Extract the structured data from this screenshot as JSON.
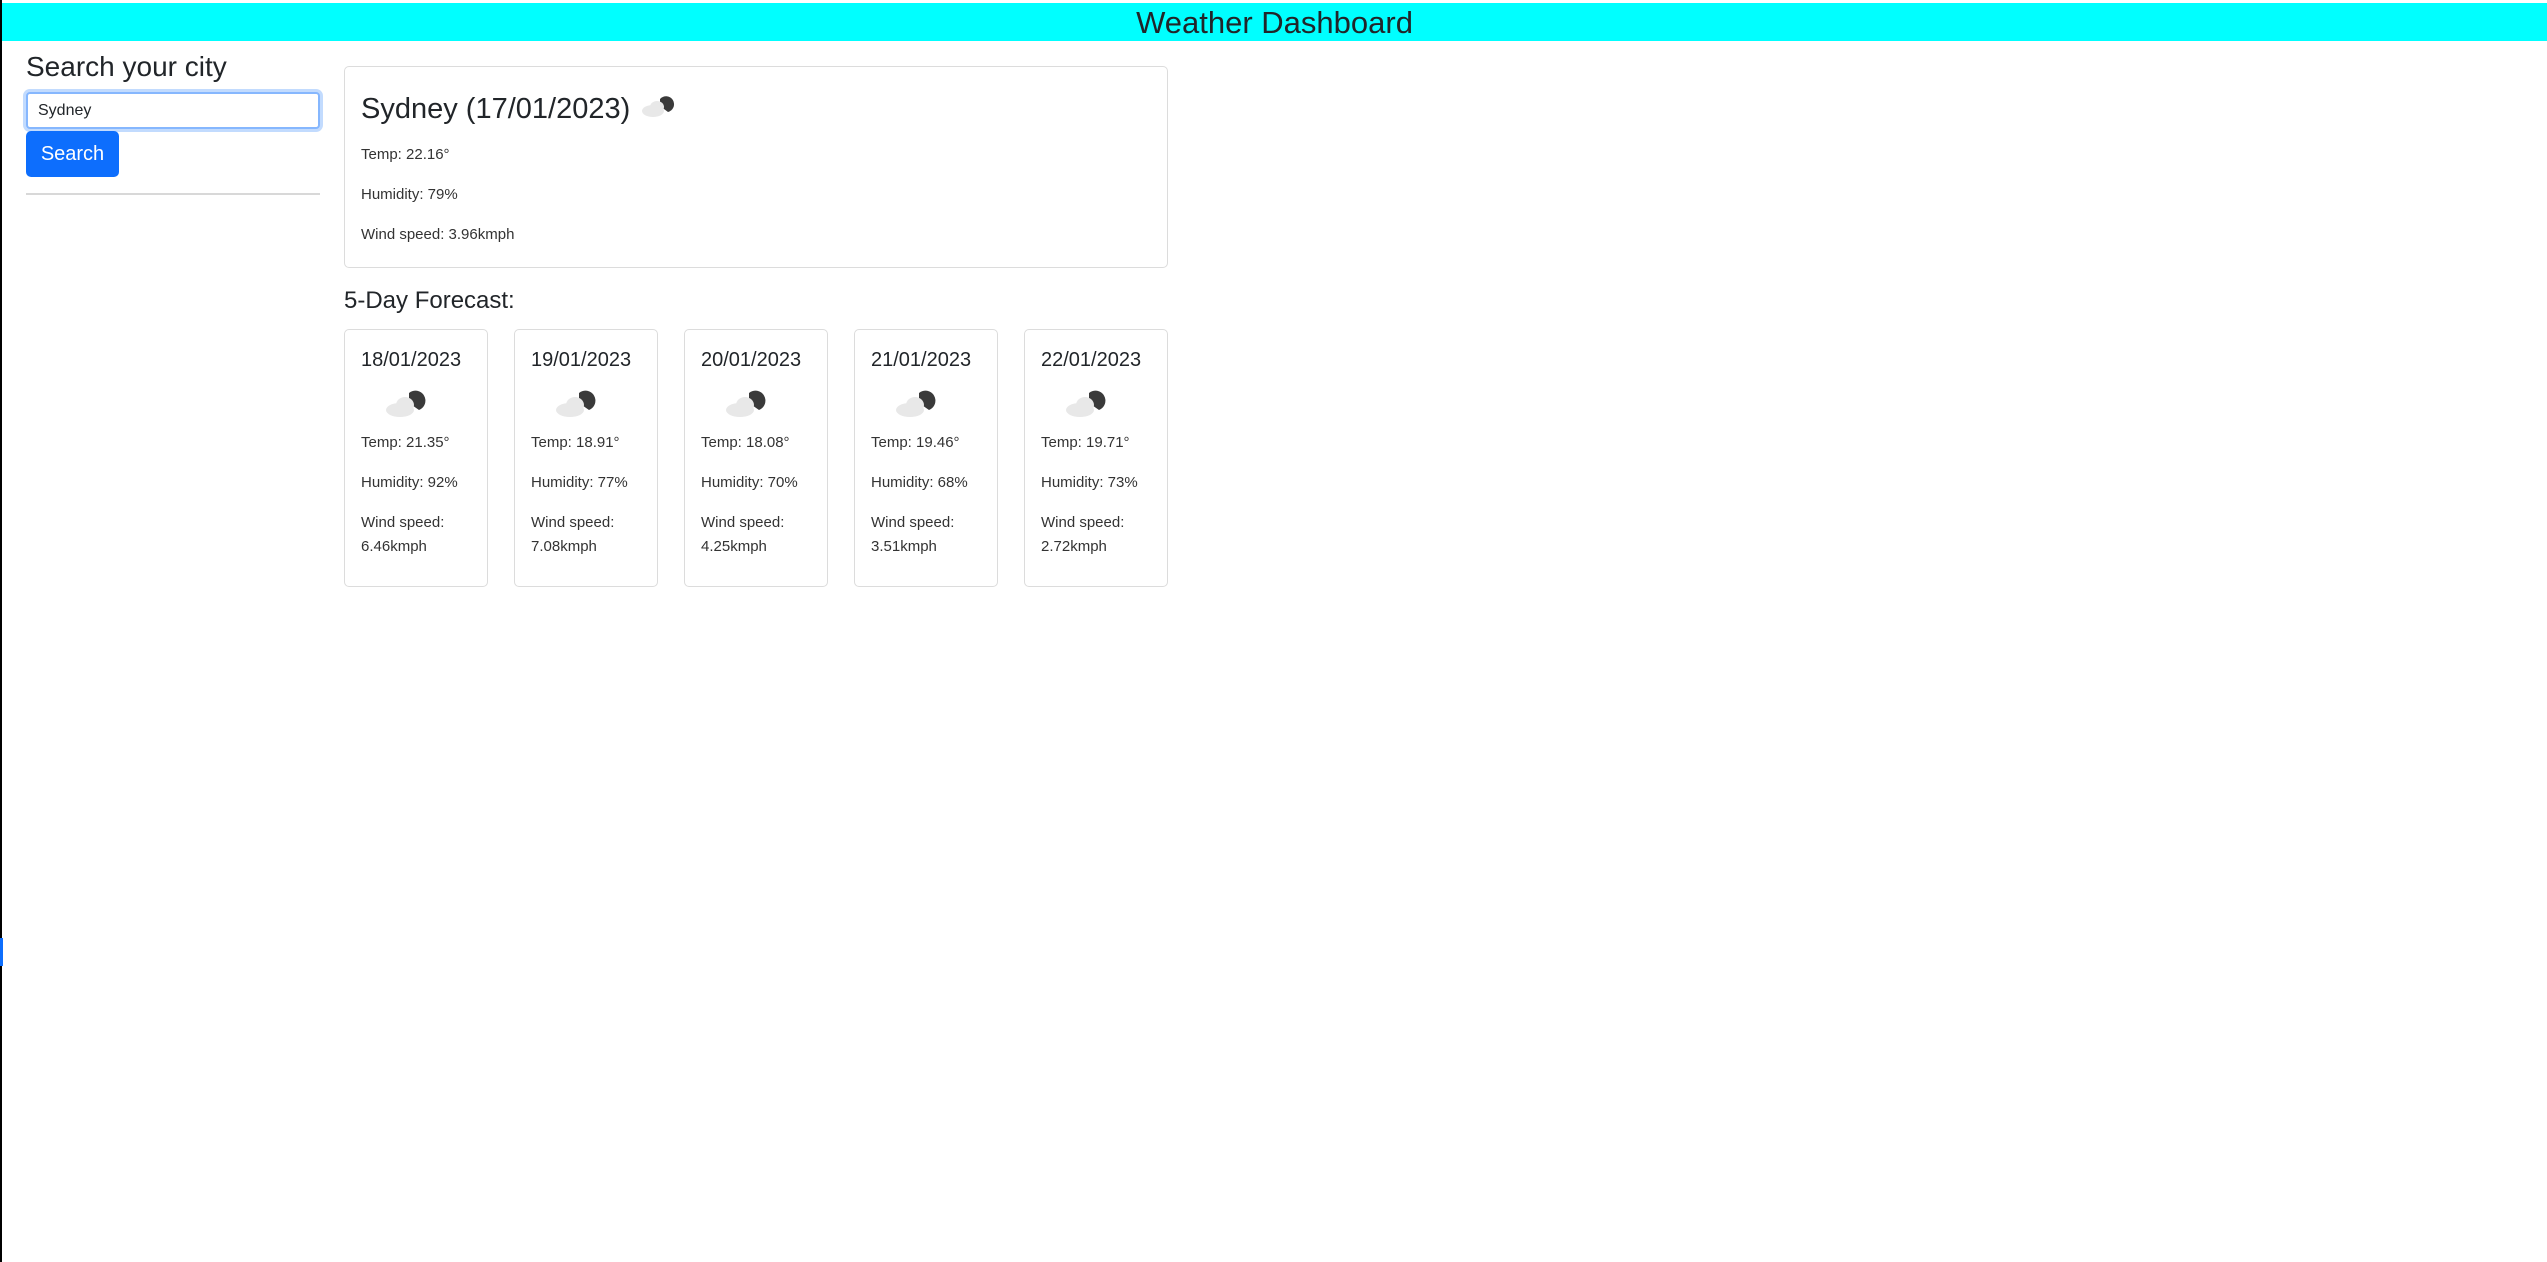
{
  "header": {
    "title": "Weather Dashboard",
    "bg_color": "#00ffff"
  },
  "sidebar": {
    "heading": "Search your city",
    "search_value": "Sydney",
    "search_button_label": "Search",
    "accent_color": "#0d6efd"
  },
  "current": {
    "title": "Sydney (17/01/2023)",
    "icon": "partly-cloudy-night-icon",
    "temp": "Temp: 22.16°",
    "humidity": "Humidity: 79%",
    "wind": "Wind speed: 3.96kmph"
  },
  "forecast": {
    "heading": "5-Day Forecast:",
    "days": [
      {
        "date": "18/01/2023",
        "icon": "partly-cloudy-night-icon",
        "temp": "Temp: 21.35°",
        "humidity": "Humidity: 92%",
        "wind_label": "Wind speed:",
        "wind_value": "6.46kmph"
      },
      {
        "date": "19/01/2023",
        "icon": "partly-cloudy-night-icon",
        "temp": "Temp: 18.91°",
        "humidity": "Humidity: 77%",
        "wind_label": "Wind speed:",
        "wind_value": "7.08kmph"
      },
      {
        "date": "20/01/2023",
        "icon": "partly-cloudy-night-icon",
        "temp": "Temp: 18.08°",
        "humidity": "Humidity: 70%",
        "wind_label": "Wind speed:",
        "wind_value": "4.25kmph"
      },
      {
        "date": "21/01/2023",
        "icon": "partly-cloudy-night-icon",
        "temp": "Temp: 19.46°",
        "humidity": "Humidity: 68%",
        "wind_label": "Wind speed:",
        "wind_value": "3.51kmph"
      },
      {
        "date": "22/01/2023",
        "icon": "partly-cloudy-night-icon",
        "temp": "Temp: 19.71°",
        "humidity": "Humidity: 73%",
        "wind_label": "Wind speed:",
        "wind_value": "2.72kmph"
      }
    ]
  }
}
